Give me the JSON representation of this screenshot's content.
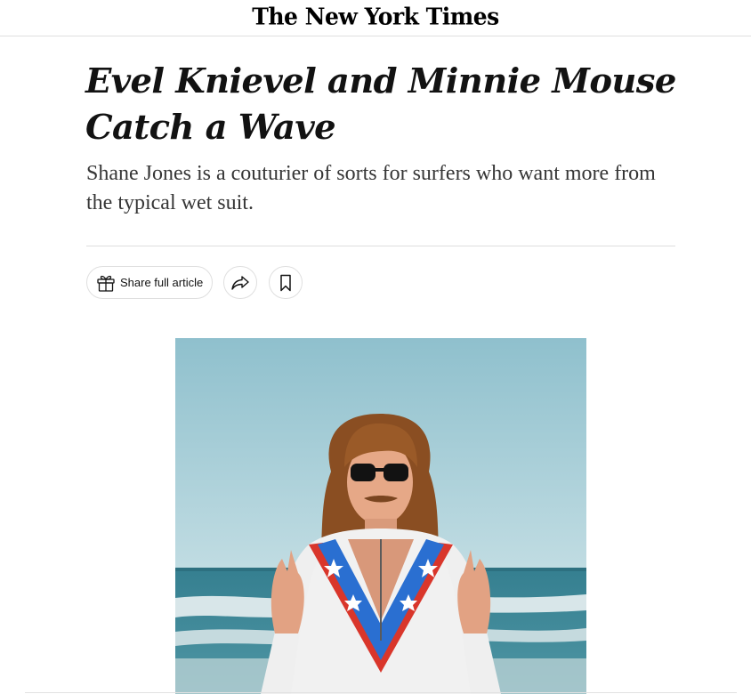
{
  "masthead": {
    "logo_text": "The New York Times"
  },
  "article": {
    "headline": "Evel Knievel and Minnie Mouse Catch a Wave",
    "summary": "Shane Jones is a couturier of sorts for surfers who want more from the typical wet suit."
  },
  "share_bar": {
    "share_full_label": "Share full article",
    "icons": [
      "gift-icon",
      "share-forward-icon",
      "bookmark-icon"
    ]
  },
  "hero_image": {
    "subject": "surfer",
    "colors": {
      "sky": "#a9cdd6",
      "ocean": "#3f8796",
      "wetsuit_blue": "#2a6fd1",
      "wetsuit_red": "#d9362b"
    }
  }
}
